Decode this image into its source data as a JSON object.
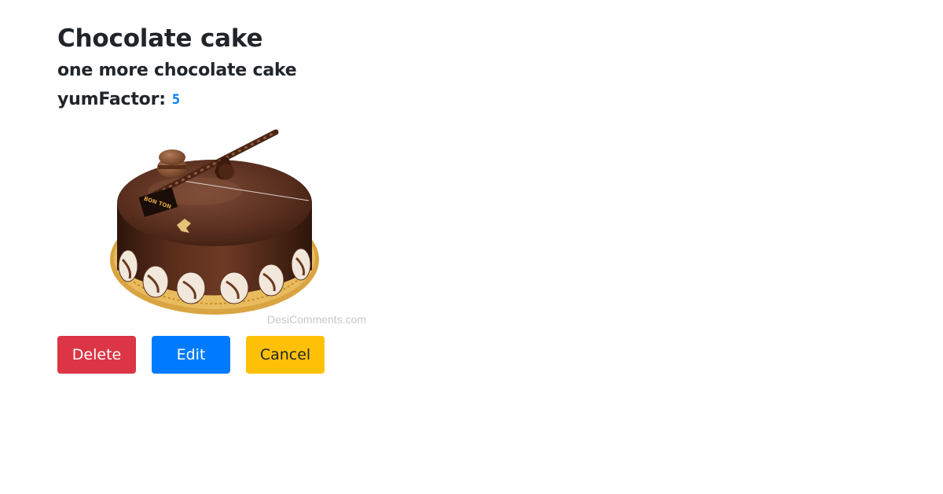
{
  "recipe": {
    "title": "Chocolate cake",
    "description": "one more chocolate cake",
    "yum_label": "yumFactor:",
    "yum_value": "5",
    "image": {
      "alt": "chocolate cake",
      "watermark": "DesiComments.com",
      "badge_text": "BON TON"
    }
  },
  "actions": {
    "delete_label": "Delete",
    "edit_label": "Edit",
    "cancel_label": "Cancel"
  },
  "colors": {
    "delete": "#dc3545",
    "edit": "#007bff",
    "cancel": "#ffc107",
    "yum_value": "#007bff"
  }
}
